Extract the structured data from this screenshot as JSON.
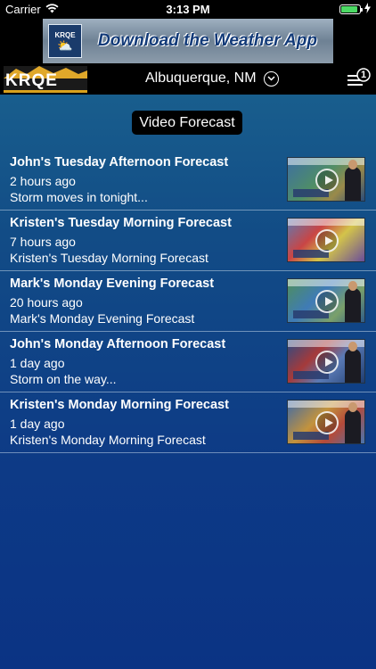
{
  "status_bar": {
    "carrier": "Carrier",
    "time": "3:13 PM",
    "battery_level": 0.9,
    "battery_color": "#4cd964"
  },
  "ad": {
    "logo_text": "KRQE",
    "text": "Download the Weather App"
  },
  "header": {
    "logo_text": "KRQE",
    "location": "Albuquerque, NM",
    "location_icon": "chevron-down-circle-icon",
    "menu_badge": "1",
    "menu_icon": "hamburger-menu-icon"
  },
  "page_title": "Video Forecast",
  "videos": [
    {
      "title": "John's Tuesday Afternoon Forecast",
      "time": "2 hours ago",
      "description": "Storm moves in tonight..."
    },
    {
      "title": "Kristen's Tuesday Morning Forecast",
      "time": "7 hours ago",
      "description": "Kristen's Tuesday Morning Forecast"
    },
    {
      "title": "Mark's Monday Evening Forecast",
      "time": "20 hours ago",
      "description": "Mark's Monday Evening Forecast"
    },
    {
      "title": "John's Monday Afternoon Forecast",
      "time": "1 day ago",
      "description": "Storm on the way..."
    },
    {
      "title": "Kristen's Monday Morning Forecast",
      "time": "1 day ago",
      "description": "Kristen's Monday Morning Forecast"
    }
  ],
  "colors": {
    "background_top": "#1d6a92",
    "background_bottom": "#0b3384",
    "logo_accent": "#d9a21b"
  }
}
